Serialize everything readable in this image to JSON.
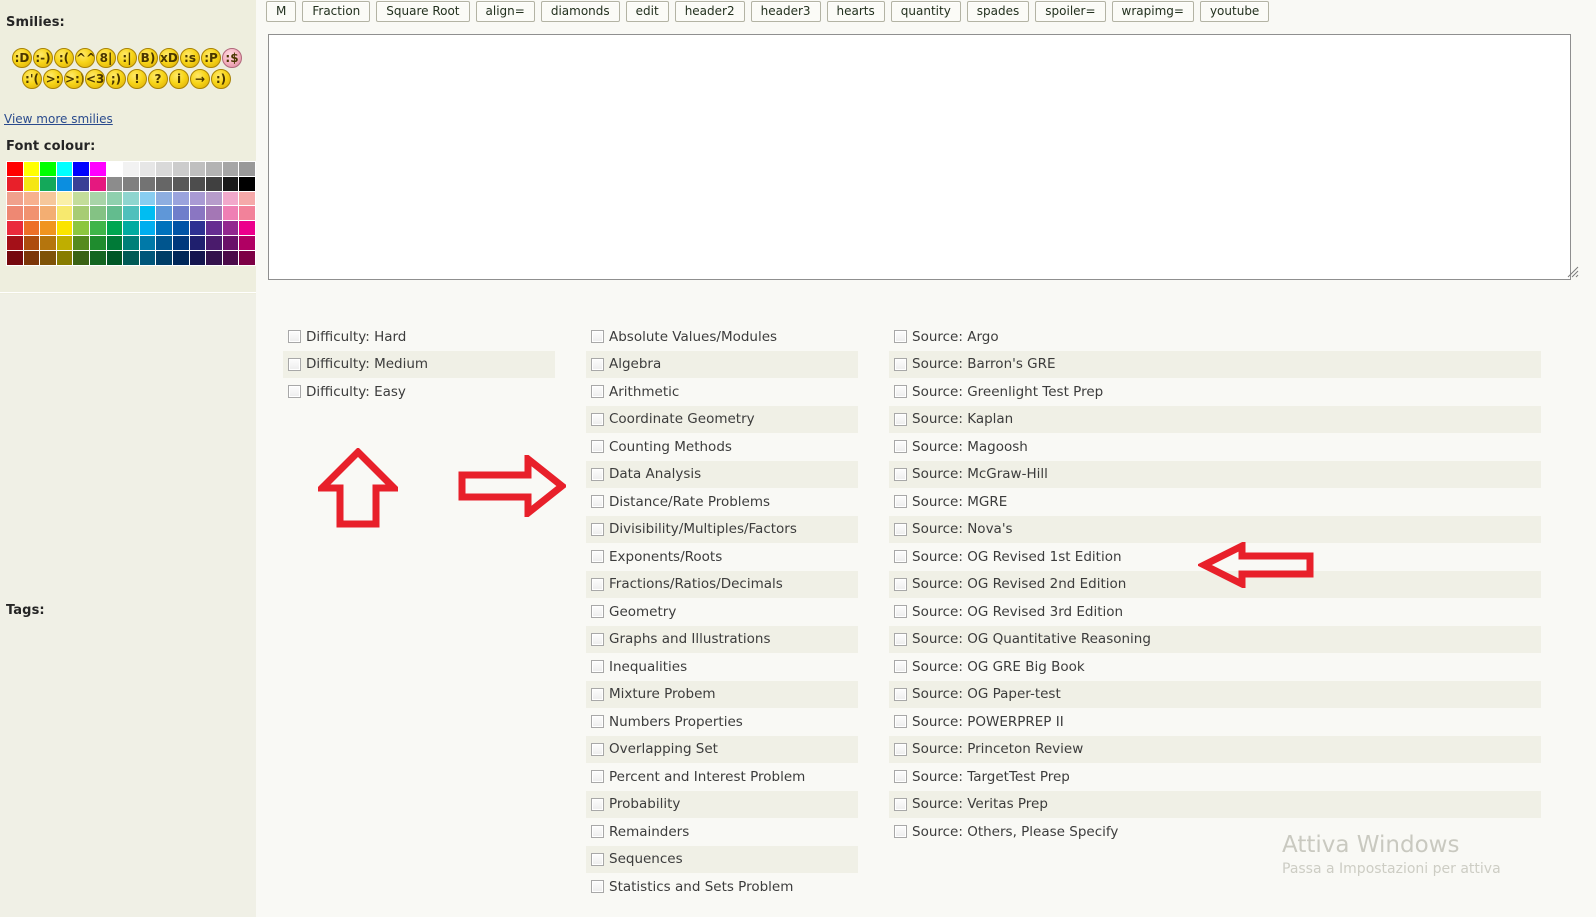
{
  "sidebar": {
    "smilies_label": "Smilies:",
    "view_more_label": "View more smilies",
    "font_colour_label": "Font colour:",
    "tags_label": "Tags:",
    "smilies": {
      "row1": [
        {
          "name": "smiley-grin",
          "glyph": ":D",
          "tone": "yellow"
        },
        {
          "name": "smiley-happy",
          "glyph": ":-)",
          "tone": "yellow"
        },
        {
          "name": "smiley-sad",
          "glyph": ":(",
          "tone": "yellow"
        },
        {
          "name": "smiley-laughing",
          "glyph": "^^",
          "tone": "yellow"
        },
        {
          "name": "smiley-nerd-glasses",
          "glyph": "8|",
          "tone": "yellow"
        },
        {
          "name": "smiley-neutral",
          "glyph": ":|",
          "tone": "yellow"
        },
        {
          "name": "smiley-cool-sunglasses",
          "glyph": "B)",
          "tone": "yellow"
        },
        {
          "name": "smiley-big-laugh",
          "glyph": "xD",
          "tone": "yellow"
        },
        {
          "name": "smiley-worried",
          "glyph": ":s",
          "tone": "yellow"
        },
        {
          "name": "smiley-tongue-out",
          "glyph": ":P",
          "tone": "yellow"
        },
        {
          "name": "smiley-blush-pink",
          "glyph": ":$",
          "tone": "pink"
        }
      ],
      "row2": [
        {
          "name": "smiley-crying",
          "glyph": ":'(",
          "tone": "yellow"
        },
        {
          "name": "smiley-devil-angry",
          "glyph": ">:(",
          "tone": "yellow"
        },
        {
          "name": "smiley-devil-evil",
          "glyph": ">:)",
          "tone": "yellow"
        },
        {
          "name": "smiley-heart-eyes",
          "glyph": "<3",
          "tone": "yellow"
        },
        {
          "name": "smiley-wink",
          "glyph": ";)",
          "tone": "yellow"
        },
        {
          "name": "smiley-exclamation",
          "glyph": "!",
          "tone": "yellow"
        },
        {
          "name": "smiley-question",
          "glyph": "?",
          "tone": "yellow"
        },
        {
          "name": "smiley-idea-bulb",
          "glyph": "i",
          "tone": "yellow"
        },
        {
          "name": "smiley-arrow-right",
          "glyph": "→",
          "tone": "yellow"
        },
        {
          "name": "smiley-smile-plain",
          "glyph": ":)",
          "tone": "yellow"
        }
      ]
    },
    "palette_rows": [
      [
        "#ff0000",
        "#ffff00",
        "#00ff00",
        "#00ffff",
        "#0000ff",
        "#ff00ff",
        "#ffffff",
        "#f2f2f2",
        "#e6e6e6",
        "#d9d9d9",
        "#cccccc",
        "#bfbfbf",
        "#b3b3b3",
        "#a6a6a6",
        "#999999"
      ],
      [
        "#e8202a",
        "#f5e614",
        "#14a85a",
        "#0b8ee0",
        "#3a3f96",
        "#e5187f",
        "#8c8c8c",
        "#808080",
        "#737373",
        "#666666",
        "#595959",
        "#4d4d4d",
        "#404040",
        "#1a1a1a",
        "#000000"
      ],
      [
        "#f0a08c",
        "#f7b08e",
        "#f6c79a",
        "#faf0a8",
        "#c3dd9a",
        "#a8d4a8",
        "#8fd0ae",
        "#8ed5cf",
        "#88cdf0",
        "#8eaee0",
        "#9aa3dd",
        "#a99ad4",
        "#b79ccb",
        "#f2a8cb",
        "#f5a9a9"
      ],
      [
        "#ee8873",
        "#f19270",
        "#f3ae72",
        "#f7e96e",
        "#a7cc74",
        "#84c284",
        "#63bc8e",
        "#4fc0bc",
        "#00bdf2",
        "#5f97d8",
        "#6f7ecb",
        "#8a76c2",
        "#a477b5",
        "#ef7fb4",
        "#f2829a"
      ],
      [
        "#ea2a3c",
        "#ed6f28",
        "#f0941f",
        "#fbe400",
        "#8cc63f",
        "#3fb54a",
        "#00a651",
        "#00aba0",
        "#00aeef",
        "#0072bc",
        "#0054a6",
        "#2e3192",
        "#662d91",
        "#92278f",
        "#ec008c",
        "#ed145b"
      ],
      [
        "#a41018",
        "#ae4c0e",
        "#b5750d",
        "#bfae00",
        "#558a1e",
        "#1f8c2e",
        "#007a37",
        "#007f78",
        "#0079a8",
        "#00558e",
        "#00387c",
        "#1f1f6e",
        "#4a1b6c",
        "#6a1069",
        "#b00063"
      ],
      [
        "#75080e",
        "#7c3508",
        "#7f5308",
        "#877c00",
        "#3a6214",
        "#146621",
        "#005726",
        "#005a55",
        "#00567a",
        "#003d66",
        "#002759",
        "#15154e",
        "#34124c",
        "#4c0b4a",
        "#7d0045"
      ]
    ]
  },
  "editor": {
    "bbcode_buttons": [
      {
        "name": "bb-button-m",
        "label": "M"
      },
      {
        "name": "bb-button-fraction",
        "label": "Fraction"
      },
      {
        "name": "bb-button-square-root",
        "label": "Square Root"
      },
      {
        "name": "bb-button-align",
        "label": "align="
      },
      {
        "name": "bb-button-diamonds",
        "label": "diamonds"
      },
      {
        "name": "bb-button-edit",
        "label": "edit"
      },
      {
        "name": "bb-button-header2",
        "label": "header2"
      },
      {
        "name": "bb-button-header3",
        "label": "header3"
      },
      {
        "name": "bb-button-hearts",
        "label": "hearts"
      },
      {
        "name": "bb-button-quantity",
        "label": "quantity"
      },
      {
        "name": "bb-button-spades",
        "label": "spades"
      },
      {
        "name": "bb-button-spoiler",
        "label": "spoiler="
      },
      {
        "name": "bb-button-wrapimg",
        "label": "wrapimg="
      },
      {
        "name": "bb-button-youtube",
        "label": "youtube"
      }
    ],
    "message_value": "",
    "message_placeholder": ""
  },
  "tags": {
    "difficulty": [
      "Difficulty: Hard",
      "Difficulty: Medium",
      "Difficulty: Easy"
    ],
    "topics": [
      "Absolute Values/Modules",
      "Algebra",
      "Arithmetic",
      "Coordinate Geometry",
      "Counting Methods",
      "Data Analysis",
      "Distance/Rate Problems",
      "Divisibility/Multiples/Factors",
      "Exponents/Roots",
      "Fractions/Ratios/Decimals",
      "Geometry",
      "Graphs and Illustrations",
      "Inequalities",
      "Mixture Probem",
      "Numbers Properties",
      "Overlapping Set",
      "Percent and Interest Problem",
      "Probability",
      "Remainders",
      "Sequences",
      "Statistics and Sets Problem"
    ],
    "sources": [
      "Source: Argo",
      "Source: Barron's GRE",
      "Source: Greenlight Test Prep",
      "Source: Kaplan",
      "Source: Magoosh",
      "Source: McGraw-Hill",
      "Source: MGRE",
      "Source: Nova's",
      "Source: OG Revised 1st Edition",
      "Source: OG Revised 2nd Edition",
      "Source: OG Revised 3rd Edition",
      "Source: OG Quantitative Reasoning",
      "Source: OG GRE Big Book",
      "Source: OG Paper-test",
      "Source: POWERPREP II",
      "Source: Princeton Review",
      "Source: TargetTest Prep",
      "Source: Veritas Prep",
      "Source: Others, Please Specify"
    ]
  },
  "annotations": {
    "arrow_color": "#e8202a",
    "arrows": [
      {
        "name": "annotation-arrow-up",
        "direction": "up"
      },
      {
        "name": "annotation-arrow-right",
        "direction": "right"
      },
      {
        "name": "annotation-arrow-left",
        "direction": "left"
      }
    ]
  },
  "watermark": {
    "title": "Attiva Windows",
    "subtitle": "Passa a Impostazioni per attiva"
  }
}
